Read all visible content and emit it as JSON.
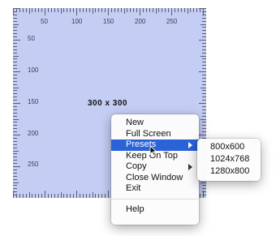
{
  "ruler": {
    "horizontal_labels": [
      "50",
      "100",
      "150",
      "200",
      "250"
    ],
    "vertical_labels": [
      "50",
      "100",
      "150",
      "200",
      "250"
    ],
    "size_readout": "300 x 300",
    "background_color": "#c4cdf3"
  },
  "context_menu": {
    "items": [
      {
        "label": "New"
      },
      {
        "label": "Full Screen"
      },
      {
        "label": "Presets",
        "highlighted": true,
        "has_submenu": true
      },
      {
        "label": "Keep On Top"
      },
      {
        "label": "Copy",
        "has_submenu": true
      },
      {
        "label": "Close Window"
      },
      {
        "label": "Exit"
      }
    ],
    "help_label": "Help"
  },
  "presets_submenu": {
    "items": [
      "800x600",
      "1024x768",
      "1280x800"
    ]
  },
  "highlight_color": "#2a62d8"
}
